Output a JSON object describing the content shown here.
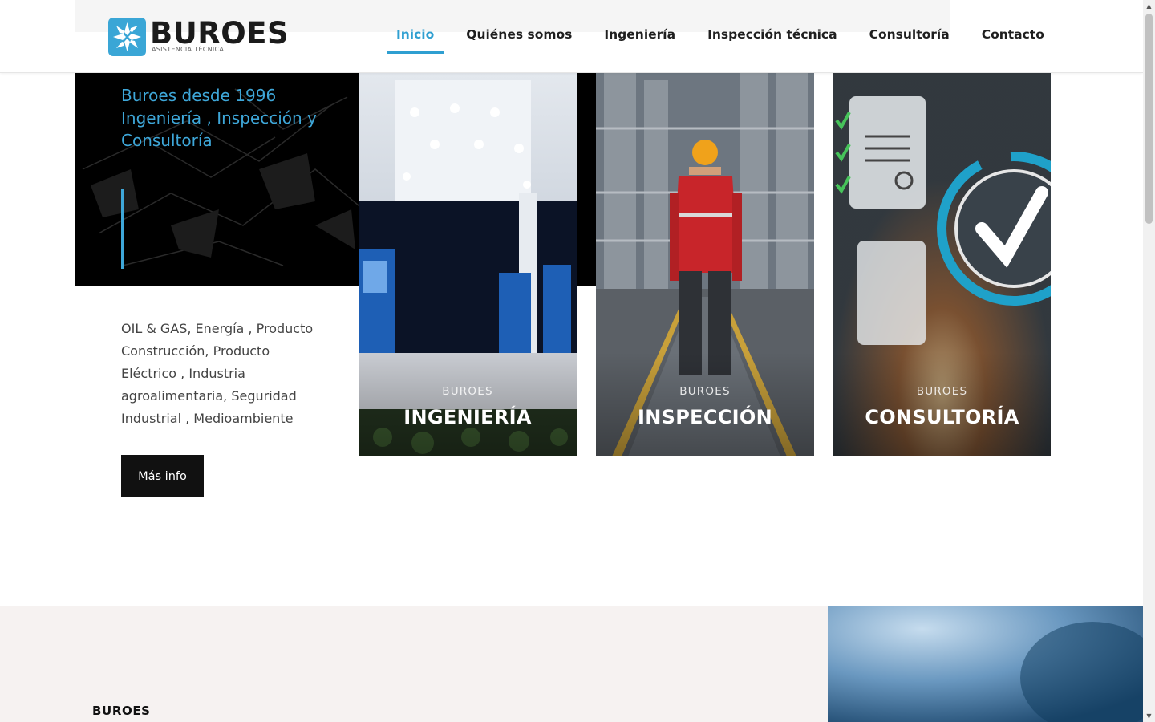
{
  "header": {
    "logo": {
      "word": "BUROES",
      "subtitle": "ASISTENCIA TÉCNICA"
    },
    "nav": [
      {
        "label": "Inicio",
        "active": true
      },
      {
        "label": "Quiénes somos",
        "active": false
      },
      {
        "label": "Ingeniería",
        "active": false
      },
      {
        "label": "Inspección técnica",
        "active": false
      },
      {
        "label": "Consultoría",
        "active": false
      },
      {
        "label": "Contacto",
        "active": false
      }
    ]
  },
  "hero": {
    "tagline": "Buroes desde 1996 Ingeniería , Inspección y Consultoría",
    "sectors": "OIL & GAS, Energía , Producto Construcción, Producto Eléctrico , Industria agroalimentaria, Seguridad Industrial , Medioambiente",
    "cta_label": "Más info"
  },
  "cards": [
    {
      "kicker": "BUROES",
      "title": "INGENIERÍA",
      "icon": "fuel-station-image"
    },
    {
      "kicker": "BUROES",
      "title": "INSPECCIÓN",
      "icon": "industrial-worker-image"
    },
    {
      "kicker": "BUROES",
      "title": "CONSULTORÍA",
      "icon": "checklist-approval-image"
    }
  ],
  "lower": {
    "title": "BUROES"
  },
  "colors": {
    "accent": "#2f9fd1",
    "dark": "#000000",
    "button": "#111111",
    "section_bg": "#f6f2f1"
  }
}
